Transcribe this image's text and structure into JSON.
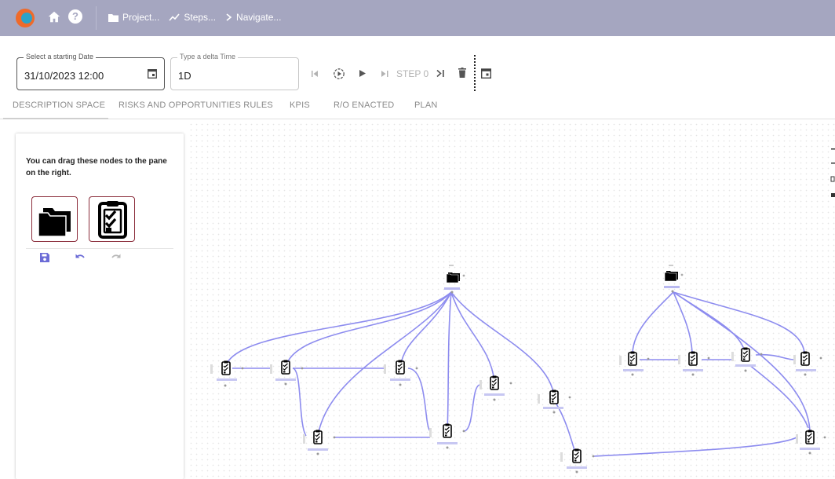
{
  "topbar": {
    "breadcrumbs": [
      {
        "label": "Project...",
        "icon": "folder-icon"
      },
      {
        "label": "Steps...",
        "icon": "trending-icon"
      },
      {
        "label": "Navigate...",
        "icon": "chevron-right-icon"
      }
    ],
    "colors": {
      "bar": "#a5a6c0",
      "logo_outer": "#ef6a2a",
      "logo_inner": "#2ba3c7"
    }
  },
  "controls": {
    "start_date": {
      "label": "Select a starting Date",
      "value": "31/10/2023 12:00"
    },
    "delta_time": {
      "label": "Type a delta Time",
      "value": "1D"
    },
    "step_label": "STEP 0"
  },
  "tabs": [
    {
      "label": "DESCRIPTION SPACE",
      "active": true
    },
    {
      "label": "RISKS AND OPPORTUNITIES RULES",
      "active": false
    },
    {
      "label": "KPIS",
      "active": false
    },
    {
      "label": "R/O ENACTED",
      "active": false
    },
    {
      "label": "PLAN",
      "active": false
    }
  ],
  "palette": {
    "help_text": "You can drag these nodes to the pane on the right.",
    "node_types": [
      "project-node",
      "task-node"
    ],
    "tools": [
      "save-icon",
      "undo-icon",
      "redo-icon"
    ],
    "accent": "#6b6bd6",
    "node_border": "#8b2d3b"
  },
  "graph": {
    "edge_color": "#8d8cef"
  }
}
